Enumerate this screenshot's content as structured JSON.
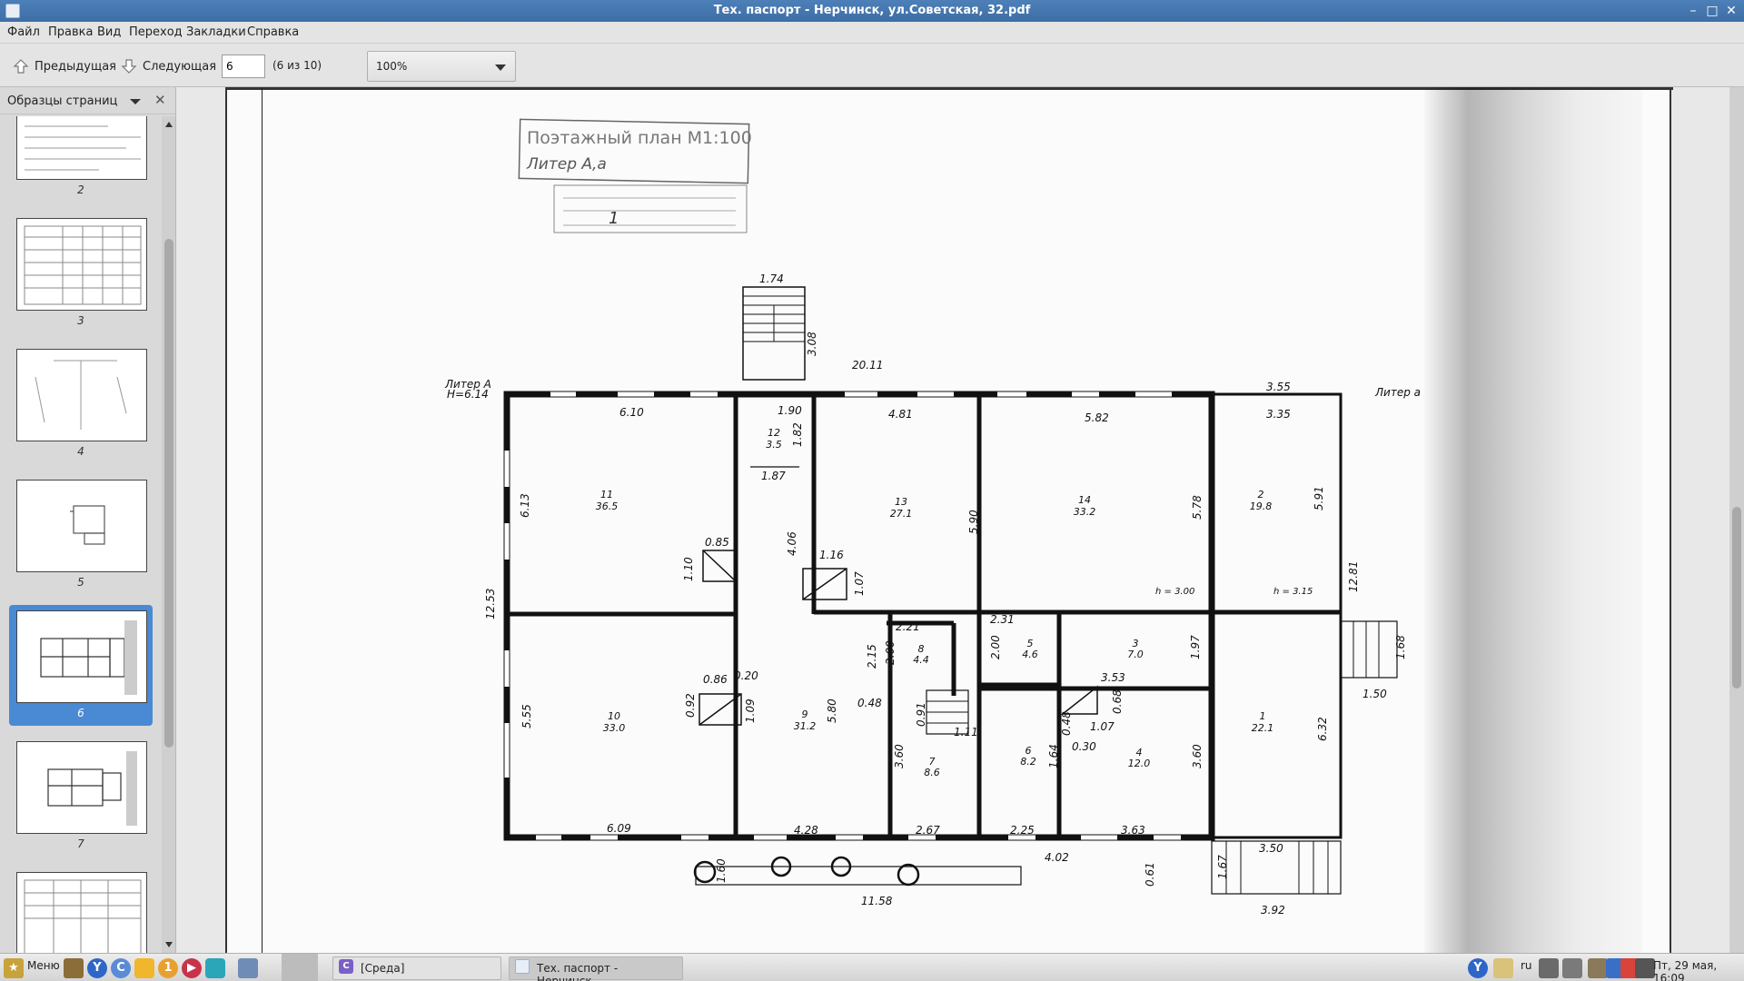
{
  "window": {
    "title": "Тех. паспорт - Нерчинск, ул.Советская, 32.pdf",
    "controls": [
      "minimize",
      "maximize",
      "close"
    ]
  },
  "menu": [
    "Файл",
    "Правка",
    "Вид",
    "Переход",
    "Закладки",
    "Справка"
  ],
  "toolbar": {
    "prev_label": "Предыдущая",
    "next_label": "Следующая",
    "page_value": "6",
    "page_count": "(6 из 10)",
    "zoom_value": "100%"
  },
  "sidebar": {
    "title": "Образцы страниц",
    "thumbnails": [
      {
        "num": "2"
      },
      {
        "num": "3"
      },
      {
        "num": "4"
      },
      {
        "num": "5"
      },
      {
        "num": "6",
        "selected": true
      },
      {
        "num": "7"
      }
    ]
  },
  "plan": {
    "stamp_line1": "Поэтажный план М1:100",
    "stamp_line2": "Литер  А,а",
    "stamp_number": "1",
    "liter_a": "Литер А",
    "liter_a_height": "Н=6.14",
    "liter_small_a": "Литер а",
    "dims": {
      "d174": "1.74",
      "d308": "3.08",
      "d2011": "20.11",
      "d355": "3.55",
      "d335": "3.35",
      "d610": "6.10",
      "d190": "1.90",
      "d182": "1.82",
      "d481": "4.81",
      "d582": "5.82",
      "d613": "6.13",
      "d187": "1.87",
      "d590": "5.90",
      "d578": "5.78",
      "d591": "5.91",
      "d085": "0.85",
      "d110": "1.10",
      "d406": "4.06",
      "d116": "1.16",
      "d107": "1.07",
      "h300": "h = 3.00",
      "h315": "h = 3.15",
      "d1281": "12.81",
      "d1253": "12.53",
      "d221": "2.21",
      "d231": "2.31",
      "d215": "2.15",
      "d200a": "2.00",
      "d200b": "2.00",
      "d197": "1.97",
      "d168": "1.68",
      "d150": "1.50",
      "d086": "0.86",
      "d020": "0.20",
      "d092": "0.92",
      "d109": "1.09",
      "d048": "0.48",
      "d091": "0.91",
      "d111": "1.11",
      "d353": "3.53",
      "d068": "0.68",
      "d048b": "0.48",
      "d030": "0.30",
      "d107b": "1.07",
      "d555": "5.55",
      "d580": "5.80",
      "d360a": "3.60",
      "d164": "1.64",
      "d360b": "3.60",
      "d632": "6.32",
      "d609": "6.09",
      "d428": "4.28",
      "d267": "2.67",
      "d225": "2.25",
      "d363": "3.63",
      "d350": "3.50",
      "d160": "1.60",
      "d402": "4.02",
      "d061": "0.61",
      "d1158": "11.58",
      "d167": "1.67",
      "d392": "3.92"
    },
    "rooms": [
      {
        "n": "11",
        "a": "36.5"
      },
      {
        "n": "12",
        "a": "3.5"
      },
      {
        "n": "13",
        "a": "27.1"
      },
      {
        "n": "14",
        "a": "33.2"
      },
      {
        "n": "2",
        "a": "19.8"
      },
      {
        "n": "10",
        "a": "33.0"
      },
      {
        "n": "9",
        "a": "31.2"
      },
      {
        "n": "8",
        "a": "4.4"
      },
      {
        "n": "5",
        "a": "4.6"
      },
      {
        "n": "3",
        "a": "7.0"
      },
      {
        "n": "7",
        "a": "8.6"
      },
      {
        "n": "6",
        "a": "8.2"
      },
      {
        "n": "4",
        "a": "12.0"
      },
      {
        "n": "1",
        "a": "22.1"
      }
    ]
  },
  "taskbar": {
    "menu_label": "Меню",
    "tasks": [
      "[Среда]",
      "Тех. паспорт - Нерчинск, ..."
    ],
    "lang": "ru",
    "clock": "Пт, 29 мая, 16:09"
  },
  "colors": {
    "titlebar": "#4072ab",
    "selection": "#4a89d3",
    "chrome": "#e4e4e4"
  }
}
